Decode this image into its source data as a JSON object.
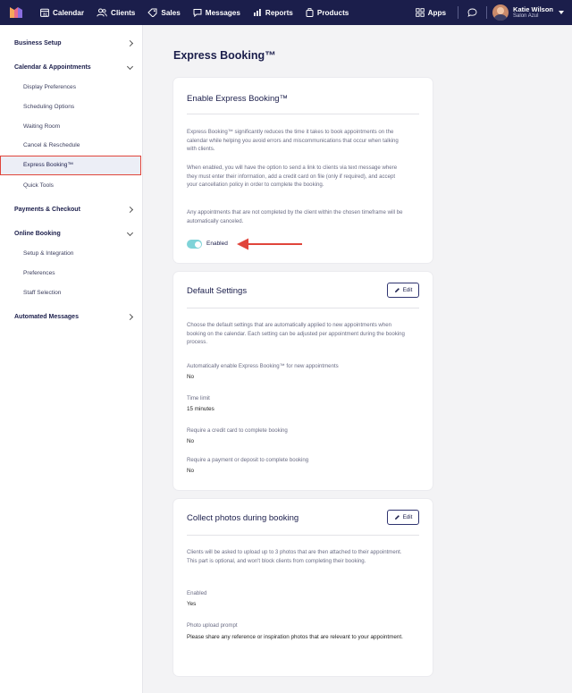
{
  "nav": {
    "items": [
      {
        "label": "Calendar",
        "icon": "calendar-icon"
      },
      {
        "label": "Clients",
        "icon": "clients-icon"
      },
      {
        "label": "Sales",
        "icon": "sales-tag-icon"
      },
      {
        "label": "Messages",
        "icon": "messages-icon"
      },
      {
        "label": "Reports",
        "icon": "reports-icon"
      },
      {
        "label": "Products",
        "icon": "products-icon"
      }
    ],
    "apps_label": "Apps",
    "user_name": "Katie Wilson",
    "salon_name": "Salon Azul"
  },
  "sidebar": {
    "business_setup": "Business Setup",
    "calendar_appointments": "Calendar & Appointments",
    "display_preferences": "Display Preferences",
    "scheduling_options": "Scheduling Options",
    "waiting_room": "Waiting Room",
    "cancel_reschedule": "Cancel & Reschedule",
    "express_booking": "Express Booking™",
    "quick_tools": "Quick Tools",
    "payments_checkout": "Payments & Checkout",
    "online_booking": "Online Booking",
    "setup_integration": "Setup & Integration",
    "preferences": "Preferences",
    "staff_selection": "Staff Selection",
    "automated_messages": "Automated Messages"
  },
  "page": {
    "title": "Express Booking™"
  },
  "enable_card": {
    "title": "Enable Express Booking™",
    "para1": "Express Booking™ significantly reduces the time it takes to book appointments on the calendar while helping you avoid errors and miscommunications that occur when talking with clients.",
    "para2": "When enabled, you will have the option to send a link to clients via text message where they must enter their information, add a credit card on file (only if required), and accept your cancellation policy in order to complete the booking.",
    "para3": "Any appointments that are not completed by the client within the chosen timeframe will be automatically canceled.",
    "toggle_label": "Enabled",
    "toggle_on": true
  },
  "defaults_card": {
    "title": "Default Settings",
    "edit_label": "Edit",
    "intro": "Choose the default settings that are automatically applied to new appointments when booking on the calendar. Each setting can be adjusted per appointment during the booking process.",
    "settings": [
      {
        "label": "Automatically enable Express Booking™ for new appointments",
        "value": "No"
      },
      {
        "label": "Time limit",
        "value": "15 minutes"
      },
      {
        "label": "Require a credit card to complete booking",
        "value": "No"
      },
      {
        "label": "Require a payment or deposit to complete booking",
        "value": "No"
      }
    ]
  },
  "photos_card": {
    "title": "Collect photos during booking",
    "edit_label": "Edit",
    "intro": "Clients will be asked to upload up to 3 photos that are then attached to their appointment. This part is optional, and won't block clients from completing their booking.",
    "enabled_label": "Enabled",
    "enabled_value": "Yes",
    "prompt_label": "Photo upload prompt",
    "prompt_value": "Please share any reference or inspiration photos that are relevant to your appointment."
  },
  "colors": {
    "nav_bg": "#1b1e4b",
    "toggle_on": "#7fd3d8",
    "highlight": "#e0453b"
  }
}
